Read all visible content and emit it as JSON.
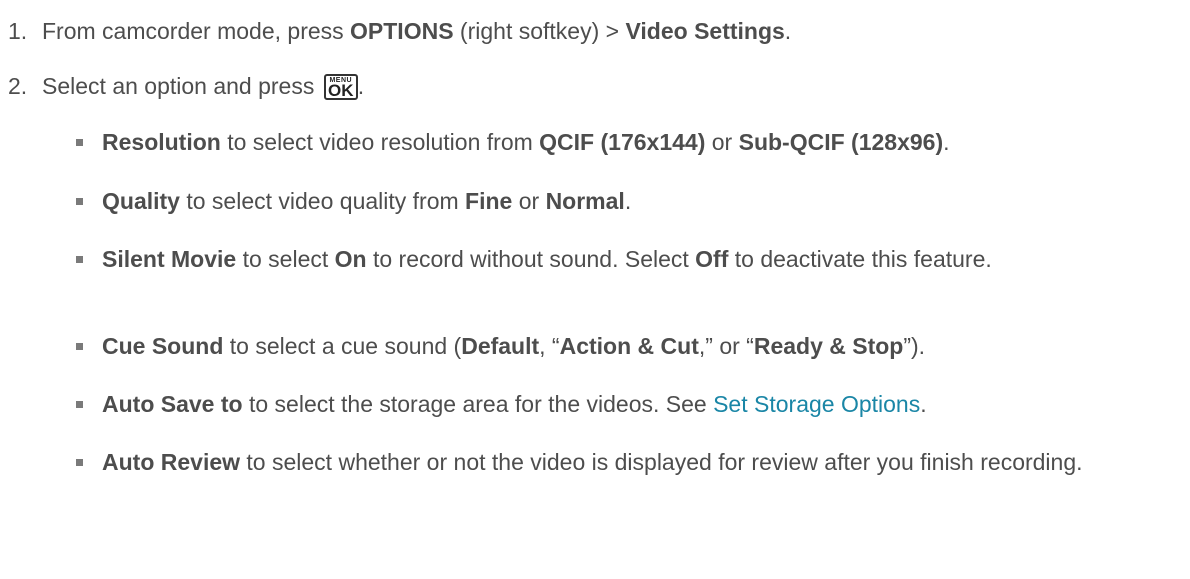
{
  "steps": [
    {
      "number": "1.",
      "t1": "From camcorder mode, press ",
      "b1": "OPTIONS",
      "t2": " (right softkey) > ",
      "b2": "Video Settings",
      "t3": "."
    },
    {
      "number": "2.",
      "t1": "Select an option and press ",
      "key_top": "MENU",
      "key_bottom": "OK",
      "t2": "."
    }
  ],
  "options": {
    "resolution": {
      "b1": "Resolution",
      "t1": " to select video resolution from ",
      "b2": "QCIF (176x144)",
      "t2": " or ",
      "b3": "Sub-QCIF (128x96)",
      "t3": "."
    },
    "quality": {
      "b1": "Quality",
      "t1": " to select video quality from ",
      "b2": "Fine",
      "t2": " or ",
      "b3": "Normal",
      "t3": "."
    },
    "silent_movie": {
      "b1": "Silent Movie",
      "t1": " to select ",
      "b2": "On",
      "t2": " to record without sound. Select ",
      "b3": "Off",
      "t3": " to deactivate this feature."
    },
    "cue_sound": {
      "b1": "Cue Sound",
      "t1": " to select a cue sound (",
      "b2": "Default",
      "t2": ", “",
      "b3": "Action & Cut",
      "t3": ",” or “",
      "b4": "Ready & Stop",
      "t4": "”)."
    },
    "auto_save": {
      "b1": "Auto Save to",
      "t1": " to select the storage area for the videos. See ",
      "link": "Set Storage Options",
      "t2": "."
    },
    "auto_review": {
      "b1": "Auto Review",
      "t1": " to select whether or not the video is displayed for review after you finish recording."
    }
  },
  "colors": {
    "text": "#4d4d4d",
    "link": "#1a86a6",
    "bullet": "#7a7a7a"
  }
}
